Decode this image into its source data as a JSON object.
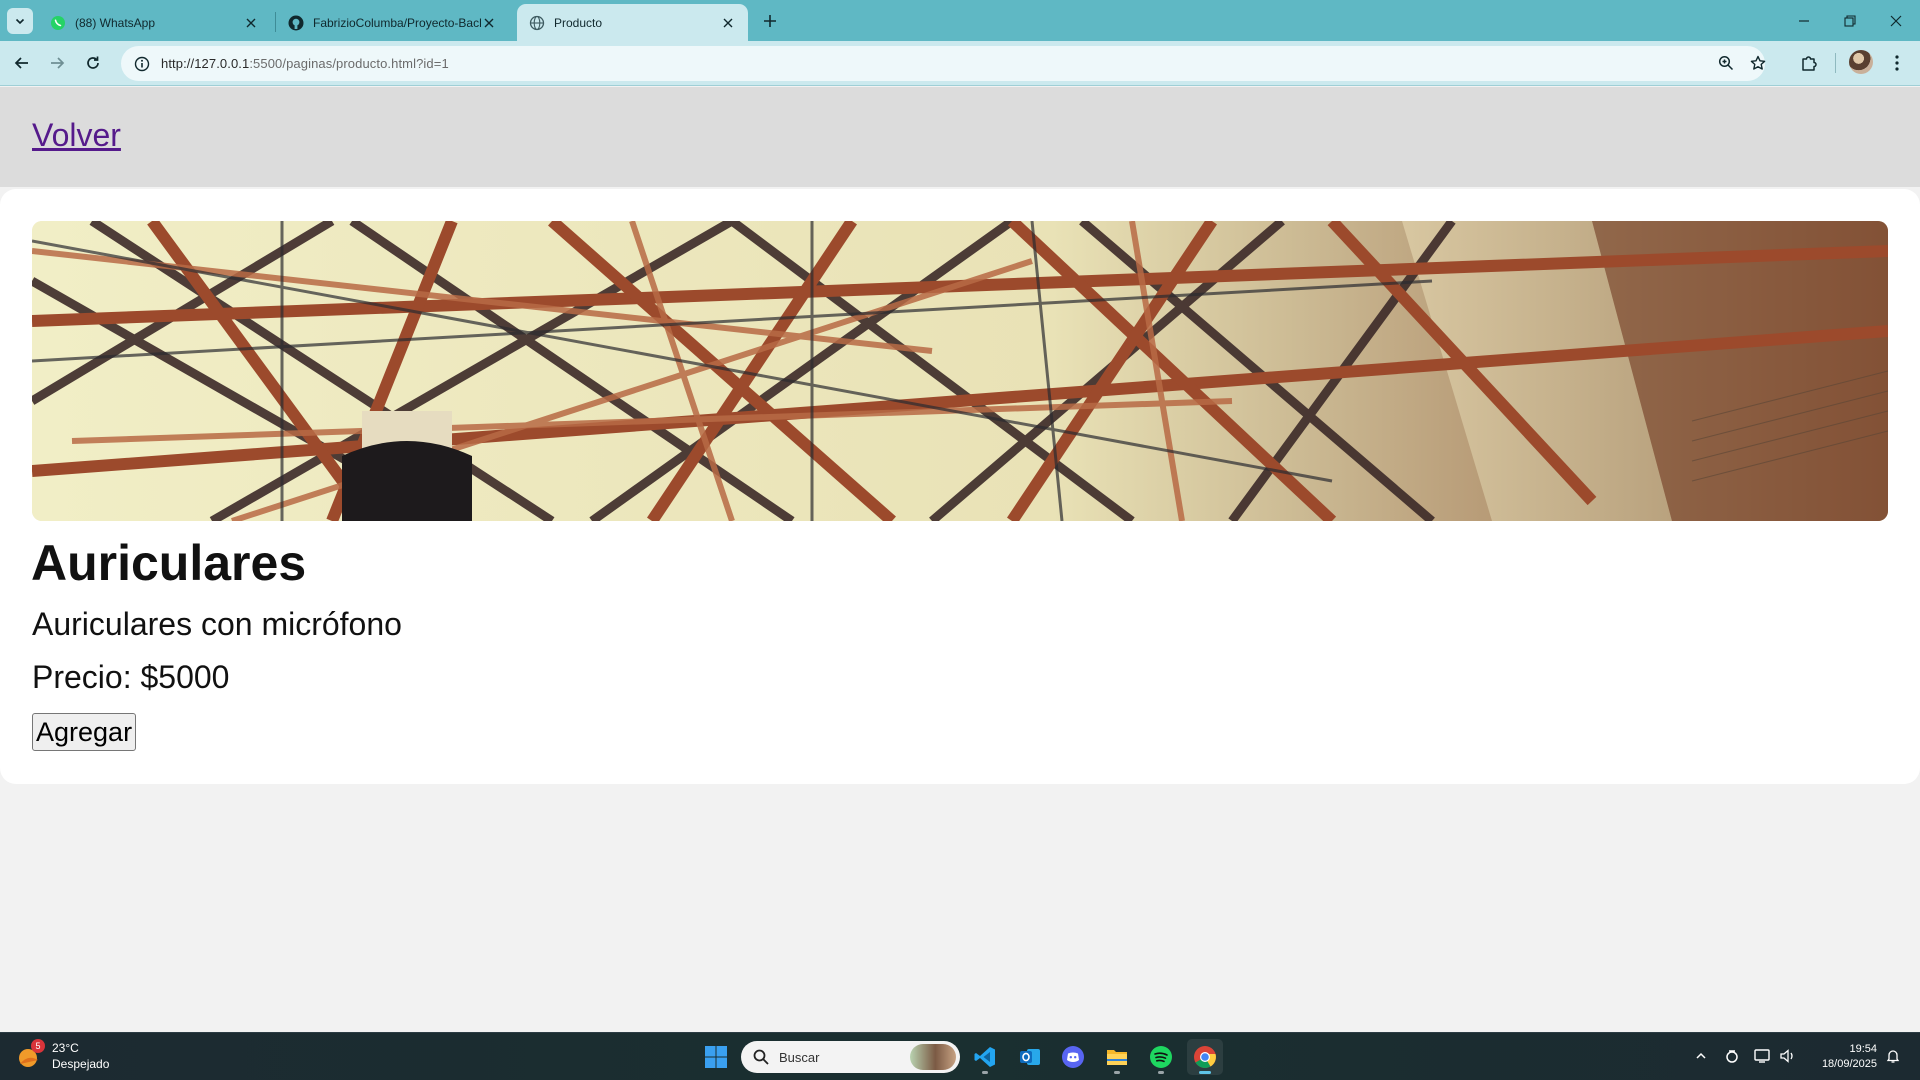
{
  "browser": {
    "tabs": [
      {
        "label": "(88) WhatsApp",
        "icon": "whatsapp-icon",
        "active": false
      },
      {
        "label": "FabrizioColumba/Proyecto-Back",
        "icon": "github-icon",
        "active": false
      },
      {
        "label": "Producto",
        "icon": "globe-icon",
        "active": true
      }
    ],
    "url_host": "http://127.0.0.1",
    "url_path": ":5500/paginas/producto.html?id=1"
  },
  "page": {
    "back_link": "Volver",
    "product": {
      "title": "Auriculares",
      "description": "Auriculares con micrófono",
      "price": "Precio: $5000",
      "add_button": "Agregar"
    }
  },
  "taskbar": {
    "weather": {
      "badge": "5",
      "temp": "23°C",
      "condition": "Despejado"
    },
    "search_placeholder": "Buscar",
    "apps": [
      "windows-start-icon",
      "vscode-icon",
      "outlook-icon",
      "discord-icon",
      "file-explorer-icon",
      "spotify-icon",
      "chrome-icon"
    ],
    "time": "19:54",
    "date": "18/09/2025"
  },
  "colors": {
    "tabbar": "#5fb8c4",
    "toolbar": "#cbe9ee",
    "link_visited": "#551a8b",
    "header_band": "#dcdcdc"
  }
}
